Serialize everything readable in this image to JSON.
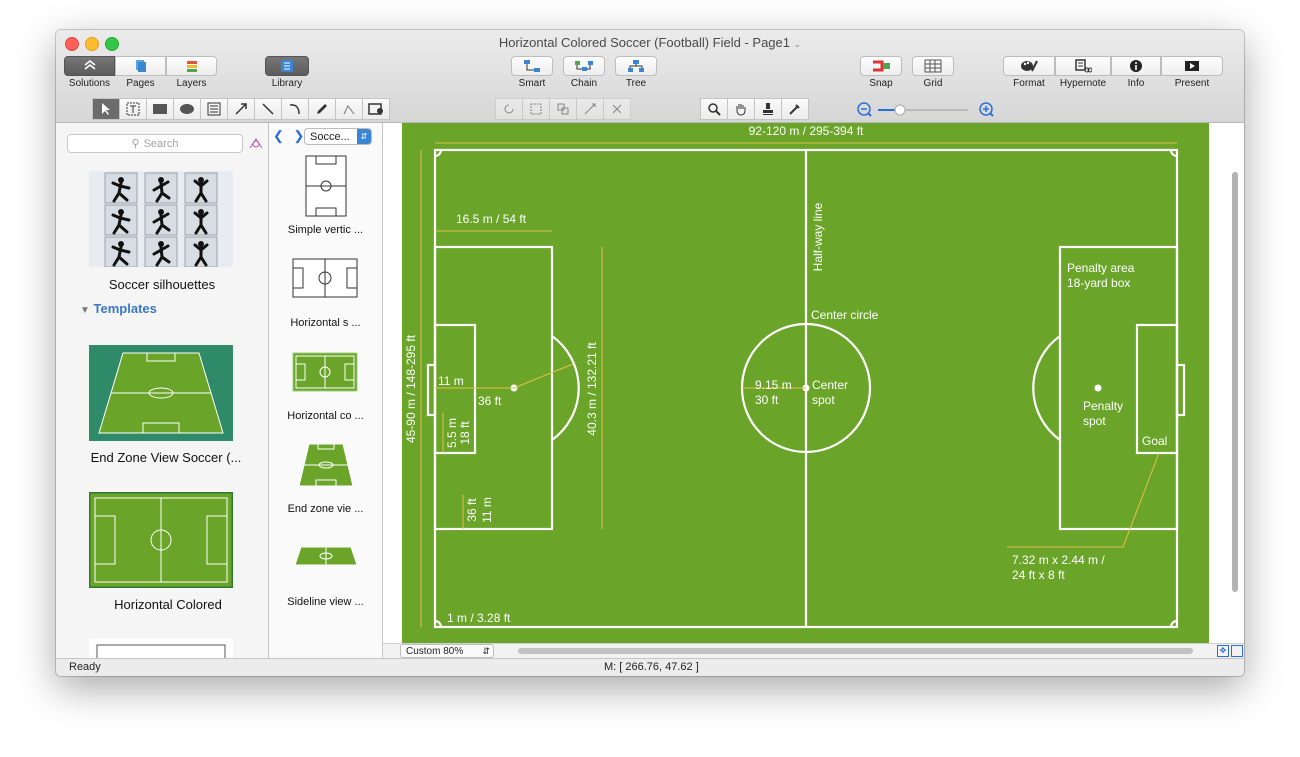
{
  "window": {
    "title": "Horizontal Colored Soccer (Football) Field - Page1"
  },
  "toolbar": {
    "solutions": "Solutions",
    "pages": "Pages",
    "layers": "Layers",
    "library": "Library",
    "smart": "Smart",
    "chain": "Chain",
    "tree": "Tree",
    "snap": "Snap",
    "grid": "Grid",
    "format": "Format",
    "hypernote": "Hypernote",
    "info": "Info",
    "present": "Present"
  },
  "sidebar": {
    "search_placeholder": "Search",
    "soccer_silhouettes": "Soccer silhouettes",
    "templates_header": "Templates",
    "templates": [
      "End Zone View Soccer (...",
      "Horizontal Colored"
    ]
  },
  "library": {
    "dropdown": "Socce...",
    "items": [
      "Simple vertic ...",
      "Horizontal s ...",
      "Horizontal co ...",
      "End zone vie ...",
      "Sideline view ..."
    ]
  },
  "field": {
    "width_label": "92-120 m / 295-394 ft",
    "length_label": "45-90 m / 148-295 ft",
    "box_width": "16.5 m / 54 ft",
    "halfway": "Half-way line",
    "box_height": "40.3 m / 132.21 ft",
    "eleven_m": "11 m",
    "thirtysix_ft": "36 ft",
    "six_m": "5.5 m",
    "eighteen_ft": "18 ft",
    "thirtysix_ft_2": "36 ft",
    "eleven_m_2": "11 m",
    "corner": "1 m / 3.28 ft",
    "center_circle": "Center circle",
    "radius_m": "9.15 m",
    "radius_ft": "30 ft",
    "center_spot_1": "Center",
    "center_spot_2": "spot",
    "penalty_area_1": "Penalty area",
    "penalty_area_2": "18-yard box",
    "penalty_spot_1": "Penalty",
    "penalty_spot_2": "spot",
    "goal": "Goal",
    "goal_size_1": "7.32 m x 2.44 m /",
    "goal_size_2": "24 ft x 8 ft"
  },
  "zoom": {
    "value": "Custom 80%"
  },
  "status": {
    "ready": "Ready",
    "mouse": "M: [ 266.76, 47.62 ]"
  },
  "colors": {
    "pitch": "#6aa52a",
    "line": "#ffffff",
    "annot": "#e3c04a"
  }
}
